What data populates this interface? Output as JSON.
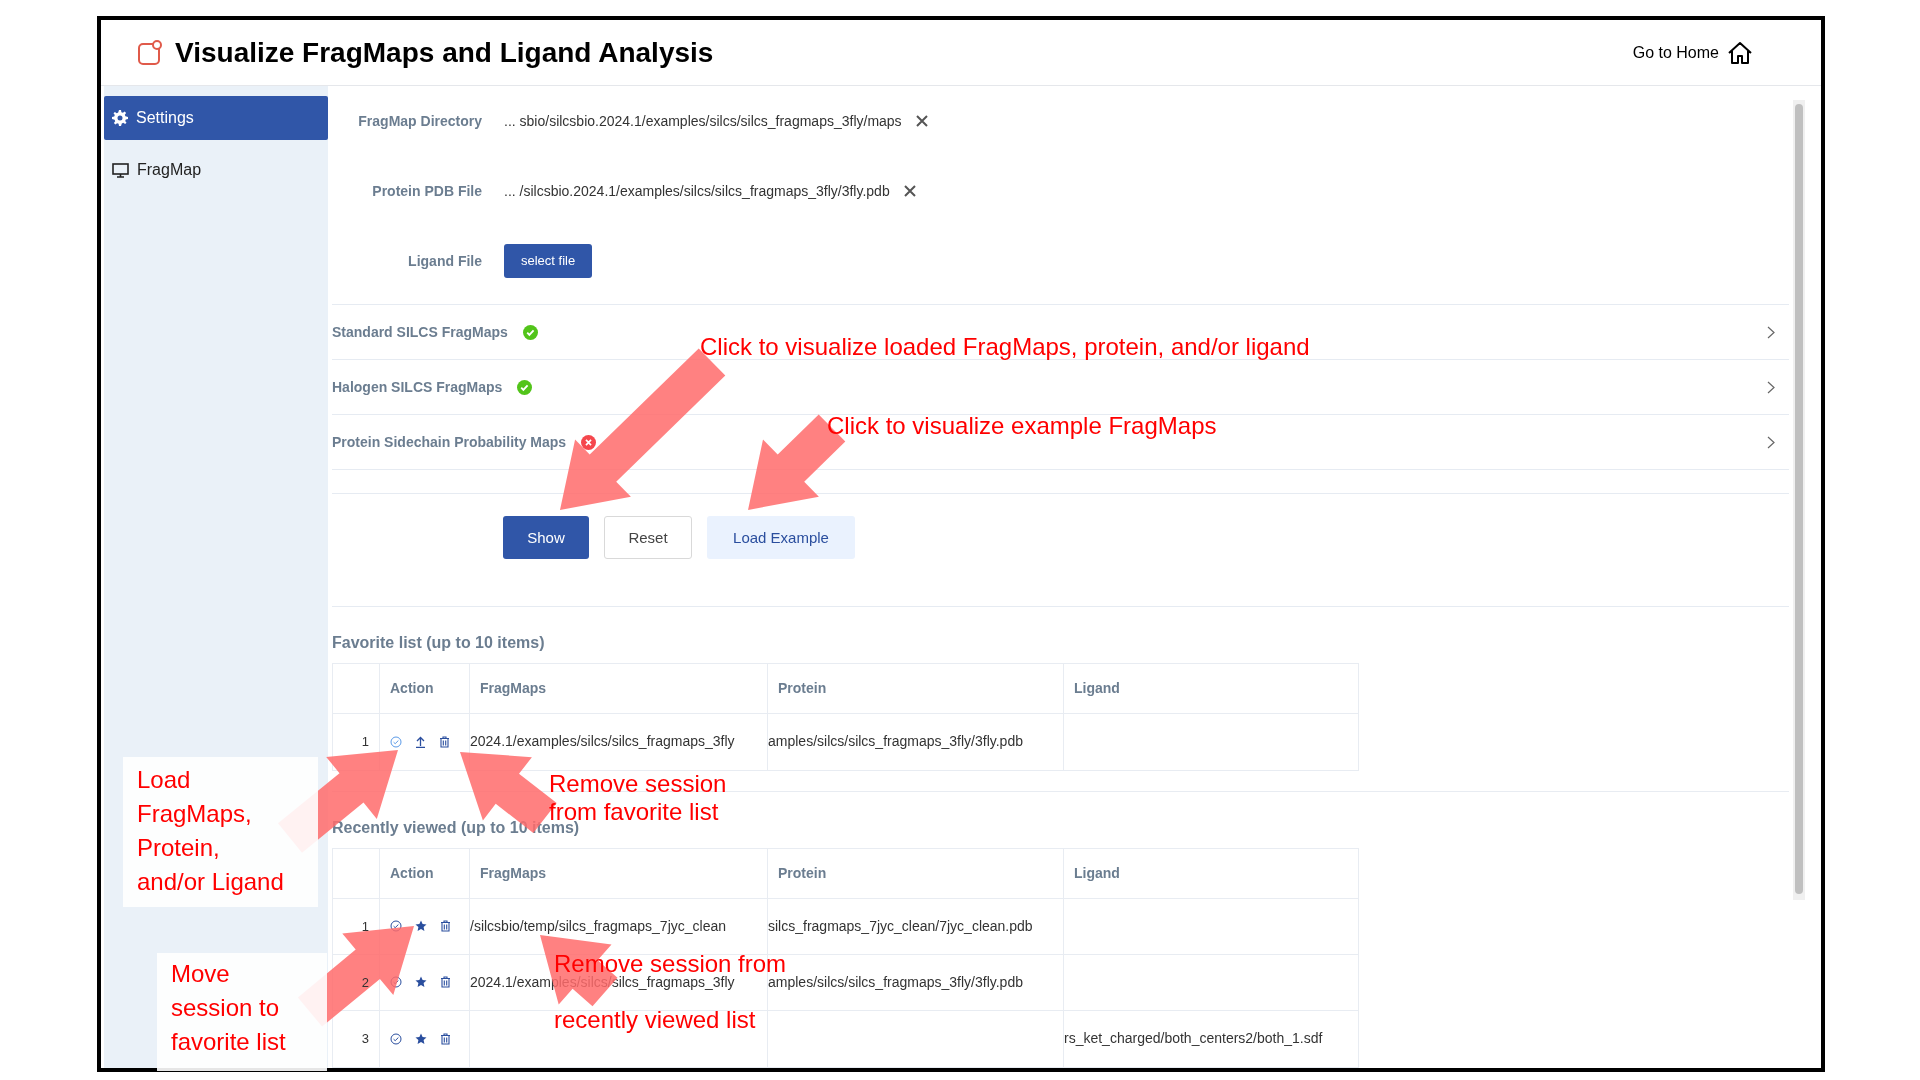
{
  "header": {
    "title": "Visualize FragMaps and Ligand Analysis",
    "home_link": "Go to Home"
  },
  "sidebar": {
    "items": [
      {
        "label": "Settings",
        "selected": true
      },
      {
        "label": "FragMap",
        "selected": false
      }
    ]
  },
  "settings": {
    "fields": [
      {
        "label": "FragMap Directory",
        "kind": "path",
        "value": "... sbio/silcsbio.2024.1/examples/silcs/silcs_fragmaps_3fly/maps"
      },
      {
        "label": "Protein PDB File",
        "kind": "path",
        "value": "... /silcsbio.2024.1/examples/silcs/silcs_fragmaps_3fly/3fly.pdb"
      },
      {
        "label": "Ligand File",
        "kind": "button",
        "button": "select file"
      }
    ],
    "sections": [
      {
        "label": "Standard SILCS FragMaps",
        "ok": true
      },
      {
        "label": "Halogen SILCS FragMaps",
        "ok": true
      },
      {
        "label": "Protein Sidechain Probability Maps",
        "ok": false
      }
    ],
    "buttons": [
      {
        "label": "Show",
        "kind": "primary"
      },
      {
        "label": "Reset",
        "kind": "default"
      },
      {
        "label": "Load Example",
        "kind": "light"
      }
    ]
  },
  "favorites": {
    "kind": "favorites",
    "title": "Favorite list (up to 10 items)",
    "columns": [
      "Action",
      "FragMaps",
      "Protein",
      "Ligand"
    ],
    "rows": [
      {
        "index": "1",
        "fragmaps": "2024.1/examples/silcs/silcs_fragmaps_3fly",
        "protein": "amples/silcs/silcs_fragmaps_3fly/3fly.pdb"
      }
    ]
  },
  "recent": {
    "kind": "recent",
    "title": "Recently viewed (up to 10 items)",
    "columns": [
      "Action",
      "FragMaps",
      "Protein",
      "Ligand"
    ],
    "rows": [
      {
        "index": "1",
        "fragmaps": "/silcsbio/temp/silcs_fragmaps_7jyc_clean",
        "protein": "silcs_fragmaps_7jyc_clean/7jyc_clean.pdb"
      },
      {
        "index": "2",
        "fragmaps": "2024.1/examples/silcs/silcs_fragmaps_3fly",
        "protein": "amples/silcs/silcs_fragmaps_3fly/3fly.pdb"
      },
      {
        "index": "3",
        "ligand": "rs_ket_charged/both_centers2/both_1.sdf"
      }
    ]
  },
  "annotations": [
    {
      "lines": [
        "Click to visualize loaded FragMaps, protein, and/or ligand"
      ]
    },
    {
      "lines": [
        "Click to visualize example FragMaps"
      ]
    },
    {
      "lines": [
        "Load",
        "FragMaps,",
        "Protein,",
        "and/or Ligand"
      ]
    },
    {
      "lines": [
        "Remove session",
        "from favorite list"
      ]
    },
    {
      "lines": [
        "Move",
        "session to",
        "favorite list"
      ]
    },
    {
      "lines": [
        "Remove session from",
        "recently viewed list"
      ]
    }
  ]
}
